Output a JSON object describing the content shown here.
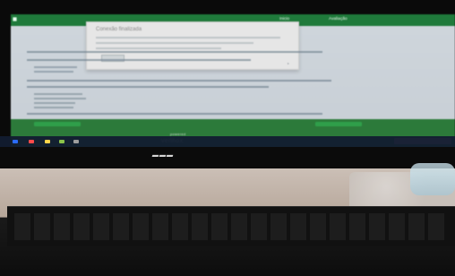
{
  "screen": {
    "brand_text": "vennox",
    "brand_small": "powered by",
    "dialog_title": "Conexão finalizada",
    "nav_1": "Inicio",
    "nav_2": "Avaliação"
  }
}
